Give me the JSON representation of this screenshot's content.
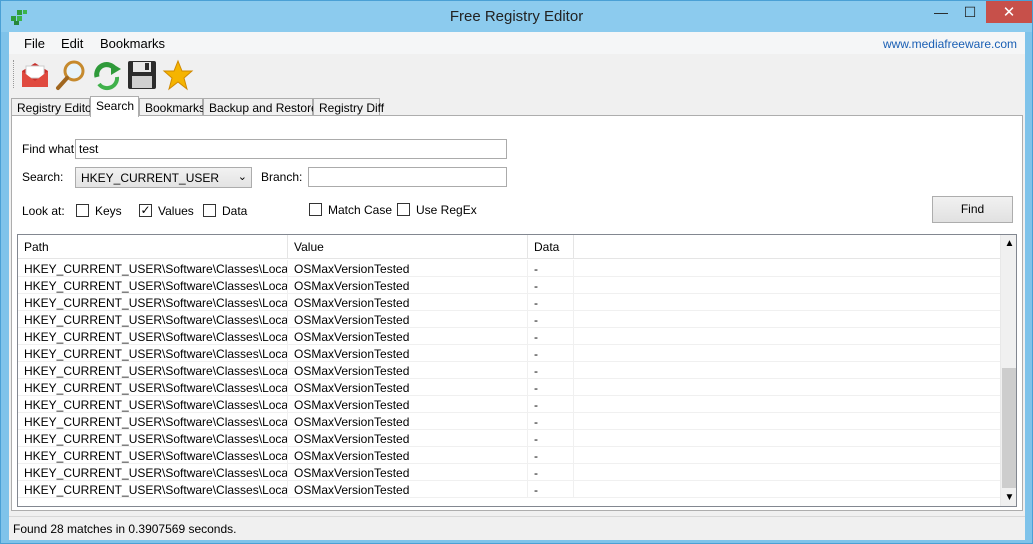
{
  "window": {
    "title": "Free Registry Editor",
    "minimize": "—",
    "maximize": "☐",
    "close": "✕"
  },
  "menu": {
    "items": [
      "File",
      "Edit",
      "Bookmarks"
    ],
    "link": "www.mediafreeware.com"
  },
  "toolbar": {
    "icons": [
      "mail-icon",
      "search-icon",
      "refresh-icon",
      "save-icon",
      "star-icon"
    ]
  },
  "tabs": [
    "Registry Editor",
    "Search",
    "Bookmarks",
    "Backup and Restore",
    "Registry Diff"
  ],
  "search": {
    "find_what_label": "Find what:",
    "find_what_value": "test",
    "search_label": "Search:",
    "search_value": "HKEY_CURRENT_USER",
    "branch_label": "Branch:",
    "branch_value": "",
    "look_at_label": "Look at:",
    "keys_label": "Keys",
    "keys_checked": false,
    "values_label": "Values",
    "values_checked": true,
    "data_label": "Data",
    "data_checked": false,
    "match_case_label": "Match Case",
    "match_case_checked": false,
    "regex_label": "Use RegEx",
    "regex_checked": false,
    "find_button": "Find"
  },
  "results": {
    "columns": [
      "Path",
      "Value",
      "Data"
    ],
    "rows": [
      {
        "path": "HKEY_CURRENT_USER\\Software\\Classes\\Local S...",
        "value": "OSMaxVersionTested",
        "data": "-"
      },
      {
        "path": "HKEY_CURRENT_USER\\Software\\Classes\\Local S...",
        "value": "OSMaxVersionTested",
        "data": "-"
      },
      {
        "path": "HKEY_CURRENT_USER\\Software\\Classes\\Local S...",
        "value": "OSMaxVersionTested",
        "data": "-"
      },
      {
        "path": "HKEY_CURRENT_USER\\Software\\Classes\\Local S...",
        "value": "OSMaxVersionTested",
        "data": "-"
      },
      {
        "path": "HKEY_CURRENT_USER\\Software\\Classes\\Local S...",
        "value": "OSMaxVersionTested",
        "data": "-"
      },
      {
        "path": "HKEY_CURRENT_USER\\Software\\Classes\\Local S...",
        "value": "OSMaxVersionTested",
        "data": "-"
      },
      {
        "path": "HKEY_CURRENT_USER\\Software\\Classes\\Local S...",
        "value": "OSMaxVersionTested",
        "data": "-"
      },
      {
        "path": "HKEY_CURRENT_USER\\Software\\Classes\\Local S...",
        "value": "OSMaxVersionTested",
        "data": "-"
      },
      {
        "path": "HKEY_CURRENT_USER\\Software\\Classes\\Local S...",
        "value": "OSMaxVersionTested",
        "data": "-"
      },
      {
        "path": "HKEY_CURRENT_USER\\Software\\Classes\\Local S...",
        "value": "OSMaxVersionTested",
        "data": "-"
      },
      {
        "path": "HKEY_CURRENT_USER\\Software\\Classes\\Local S...",
        "value": "OSMaxVersionTested",
        "data": "-"
      },
      {
        "path": "HKEY_CURRENT_USER\\Software\\Classes\\Local S...",
        "value": "OSMaxVersionTested",
        "data": "-"
      },
      {
        "path": "HKEY_CURRENT_USER\\Software\\Classes\\Local S...",
        "value": "OSMaxVersionTested",
        "data": "-"
      },
      {
        "path": "HKEY_CURRENT_USER\\Software\\Classes\\Local S...",
        "value": "OSMaxVersionTested",
        "data": "-"
      }
    ]
  },
  "status": {
    "text": "Found 28 matches in 0.3907569 seconds."
  },
  "colors": {
    "titlebar": "#8ccbee",
    "close": "#c7504a",
    "link": "#1a5fb4"
  }
}
